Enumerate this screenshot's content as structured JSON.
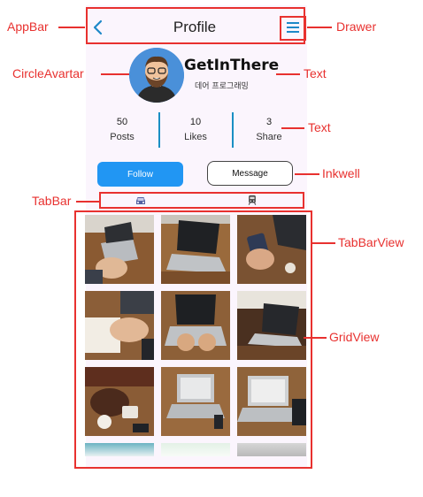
{
  "appbar": {
    "title": "Profile"
  },
  "profile": {
    "name": "GetInThere",
    "subtitle": "데어 프로그래밍"
  },
  "stats": [
    {
      "value": "50",
      "label": "Posts"
    },
    {
      "value": "10",
      "label": "Likes"
    },
    {
      "value": "3",
      "label": "Share"
    }
  ],
  "buttons": {
    "follow": "Follow",
    "message": "Message"
  },
  "tabs": [
    {
      "icon": "car-icon"
    },
    {
      "icon": "train-icon"
    }
  ],
  "annotations": {
    "appbar": "AppBar",
    "drawer": "Drawer",
    "circle_avatar": "CircleAvartar",
    "text_name": "Text",
    "text_stats": "Text",
    "inkwell": "Inkwell",
    "tabbar": "TabBar",
    "tabbarview": "TabBarView",
    "gridview": "GridView"
  },
  "colors": {
    "annotation": "#e8312f",
    "accent": "#2196f3",
    "divider": "#1a8fc4"
  }
}
